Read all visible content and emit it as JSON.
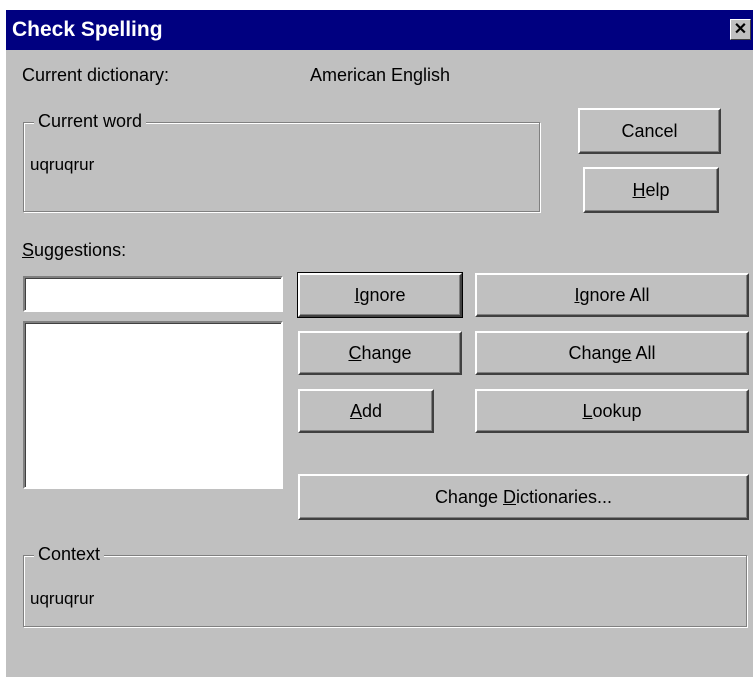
{
  "dialog": {
    "title": "Check Spelling",
    "close_glyph": "✕"
  },
  "dictionary": {
    "label": "Current dictionary:",
    "value": "American English"
  },
  "current_word": {
    "legend": "Current word",
    "value": "uqruqrur"
  },
  "buttons": {
    "cancel": "Cancel",
    "help": {
      "accel": "H",
      "rest": "elp"
    },
    "ignore": {
      "accel": "I",
      "rest": "gnore"
    },
    "ignore_all": {
      "pre": "",
      "accel": "I",
      "rest": "gnore All"
    },
    "change": {
      "accel": "C",
      "rest": "hange"
    },
    "change_all": {
      "pre": "Chang",
      "accel": "e",
      "rest": " All"
    },
    "add": {
      "accel": "A",
      "rest": "dd"
    },
    "lookup": {
      "accel": "L",
      "rest": "ookup"
    },
    "change_dictionaries": {
      "pre": "Change ",
      "accel": "D",
      "rest": "ictionaries..."
    }
  },
  "suggestions": {
    "label_accel": "S",
    "label_rest": "uggestions:",
    "input_value": "",
    "items": []
  },
  "context": {
    "legend": "Context",
    "value": "uqruqrur"
  },
  "icons": {
    "close": "close-icon"
  }
}
